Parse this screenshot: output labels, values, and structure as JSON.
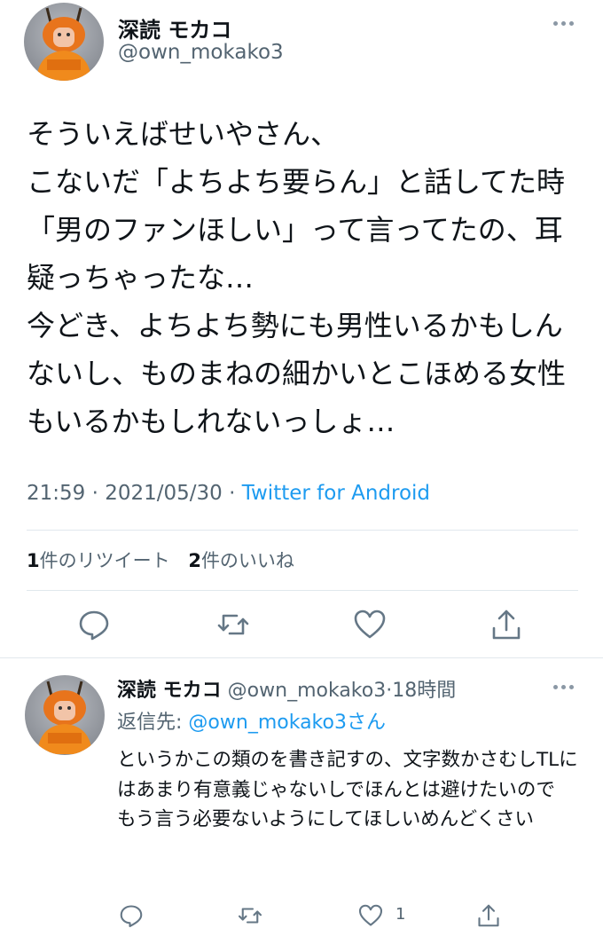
{
  "main_tweet": {
    "display_name": "深読 モカコ",
    "handle": "@own_mokako3",
    "text": "そういえばせいやさん、\nこないだ「よちよち要らん」と話してた時「男のファンほしい」って言ってたの、耳疑っちゃったな…\n今どき、よちよち勢にも男性いるかもしんないし、ものまねの細かいとこほめる女性もいるかもしれないっしょ…",
    "time": "21:59",
    "date": "2021/05/30",
    "separator": "·",
    "source": "Twitter for Android",
    "retweet_count": "1",
    "retweet_label": "件のリツイート",
    "like_count": "2",
    "like_label": "件のいいね"
  },
  "reply_tweet": {
    "display_name": "深読 モカコ",
    "handle": "@own_mokako3",
    "separator": "·",
    "time_ago": "18時間",
    "reply_to_prefix": "返信先:",
    "reply_to_handle": "@own_mokako3",
    "reply_to_suffix": "さん",
    "text": "というかこの類のを書き記すの、文字数かさむしTLにはあまり有意義じゃないしでほんとは避けたいので\nもう言う必要ないようにしてほしいめんどくさい",
    "like_count": "1"
  },
  "icons": {
    "reply": "reply-icon",
    "retweet": "retweet-icon",
    "like": "heart-icon",
    "share": "share-icon",
    "more": "more-icon"
  },
  "colors": {
    "link": "#1d9bf0",
    "secondary_text": "#536471",
    "icon": "#657786"
  }
}
